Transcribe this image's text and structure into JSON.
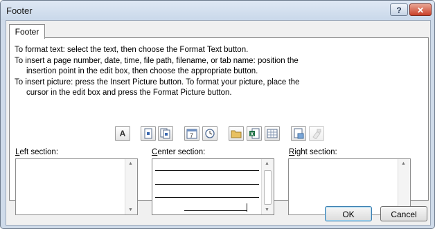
{
  "window": {
    "title": "Footer",
    "help_label": "?",
    "close_label": "✕"
  },
  "tab": {
    "label": "Footer"
  },
  "instructions": {
    "line1": "To format text:  select the text, then choose the Format Text button.",
    "line2": "To insert a page number, date, time, file path, filename, or tab name:  position the",
    "line3": "insertion point in the edit box, then choose the appropriate button.",
    "line4": "To insert picture: press the Insert Picture button.  To format your picture, place the",
    "line5": "cursor in the edit box and press the Format Picture button."
  },
  "toolbar": {
    "format_text_glyph": "A",
    "buttons": [
      "format-text",
      "insert-page-number",
      "insert-number-of-pages",
      "insert-date",
      "insert-time",
      "insert-file-path",
      "insert-file-name",
      "insert-sheet-name",
      "insert-picture",
      "format-picture"
    ]
  },
  "sections": {
    "left_label": "Left section:",
    "left_accel": "L",
    "left_rest": "eft section:",
    "center_accel": "C",
    "center_rest": "enter section:",
    "right_accel": "R",
    "right_rest": "ight section:"
  },
  "buttons": {
    "ok": "OK",
    "cancel": "Cancel"
  },
  "colors": {
    "title_bg": "#cfdbea",
    "close_red": "#c9402a",
    "default_btn_border": "#3c7fb1"
  }
}
